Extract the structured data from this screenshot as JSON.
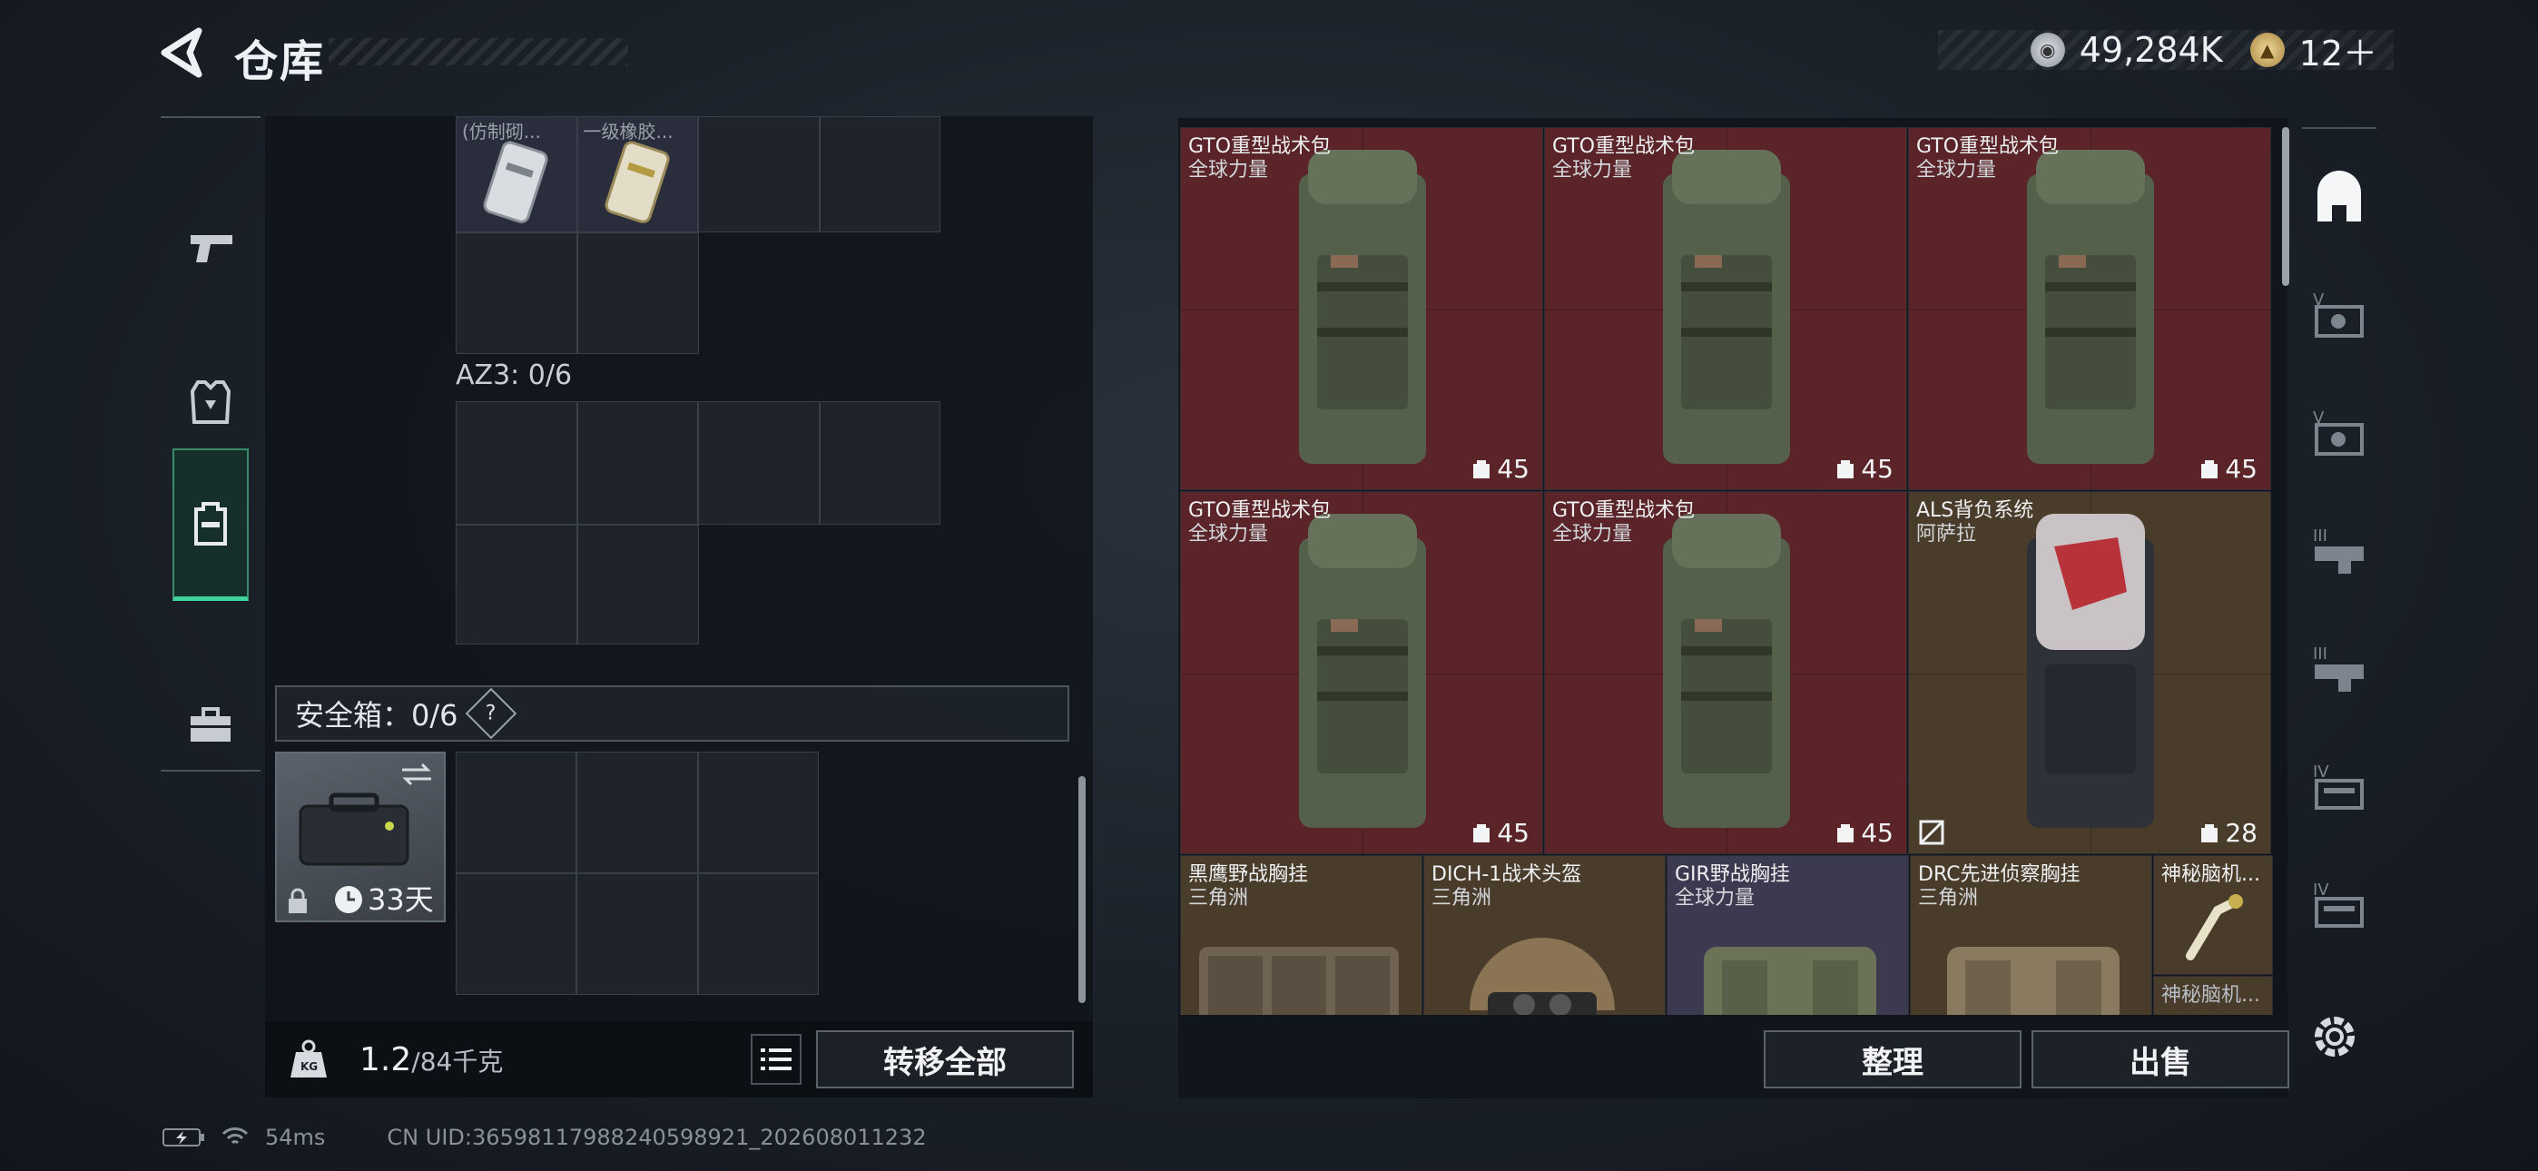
{
  "header": {
    "title": "仓库"
  },
  "currency": [
    {
      "icon": "silver-coin-icon",
      "value": "49,284K"
    },
    {
      "icon": "gold-coin-icon",
      "value": "12＋"
    }
  ],
  "left_nav": {
    "items": [
      {
        "name": "weapons",
        "icon": "pistol-icon"
      },
      {
        "name": "gear",
        "icon": "armor-icon"
      },
      {
        "name": "backpack",
        "icon": "backpack-icon",
        "active": true
      },
      {
        "name": "supplies",
        "icon": "toolbox-icon"
      }
    ]
  },
  "left": {
    "top_items": [
      {
        "label": "(仿制砌..."
      },
      {
        "label": "一级橡胶..."
      }
    ],
    "az3_label": "AZ3: 0/6",
    "safebox": {
      "label": "安全箱：0/6",
      "help": "?",
      "days": "33天"
    },
    "weight": {
      "current": "1.2",
      "max": "/84千克"
    },
    "transfer_label": "转移全部"
  },
  "right": {
    "tiles": [
      {
        "name": "GTO重型战术包",
        "sub": "全球力量",
        "cap": "45",
        "color": "red"
      },
      {
        "name": "GTO重型战术包",
        "sub": "全球力量",
        "cap": "45",
        "color": "red"
      },
      {
        "name": "GTO重型战术包",
        "sub": "全球力量",
        "cap": "45",
        "color": "red"
      },
      {
        "name": "GTO重型战术包",
        "sub": "全球力量",
        "cap": "45",
        "color": "red"
      },
      {
        "name": "GTO重型战术包",
        "sub": "全球力量",
        "cap": "45",
        "color": "red"
      },
      {
        "name": "ALS背负系统",
        "sub": "阿萨拉",
        "cap": "28",
        "color": "brown"
      },
      {
        "name": "黑鹰野战胸挂",
        "sub": "三角洲",
        "color": "brown"
      },
      {
        "name": "DICH-1战术头盔",
        "sub": "三角洲",
        "color": "brown"
      },
      {
        "name": "GIR野战胸挂",
        "sub": "全球力量",
        "color": "purple"
      },
      {
        "name": "DRC先进侦察胸挂",
        "sub": "三角洲",
        "color": "brown"
      },
      {
        "name": "神秘脑机...",
        "color": "brown"
      },
      {
        "name": "神秘脑机...",
        "color": "brown"
      }
    ],
    "sort_label": "整理",
    "sell_label": "出售"
  },
  "right_nav": {
    "items": [
      "V",
      "V",
      "III",
      "III",
      "IV",
      "IV"
    ]
  },
  "status": {
    "ping": "54ms",
    "uid": "CN UID:3659811798824059892​1_202608011232"
  }
}
